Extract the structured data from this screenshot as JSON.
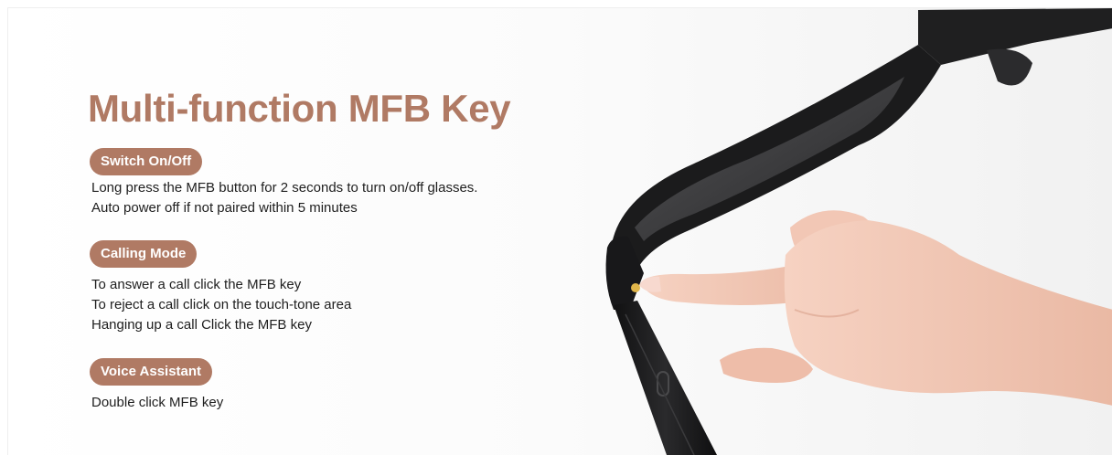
{
  "heading": "Multi-function MFB Key",
  "sections": [
    {
      "label": "Switch On/Off",
      "lines": [
        "Long press the MFB button for 2 seconds to turn on/off glasses.",
        "Auto power off if not paired within 5 minutes"
      ]
    },
    {
      "label": "Calling Mode",
      "lines": [
        "To answer a call click the MFB key",
        "To reject a call click on the touch-tone area",
        "Hanging up a call Click the MFB key"
      ]
    },
    {
      "label": "Voice Assistant",
      "lines": [
        "Double click MFB key"
      ]
    }
  ],
  "colors": {
    "accent": "#b07a64",
    "text": "#1e1e1e",
    "frame": "#1b1b1c",
    "lens": "#3c3c3e",
    "skin": "#f1c5b2",
    "button_gold": "#e1b64a"
  },
  "illustration": {
    "subject": "smart-glasses-with-finger-pressing-mfb-key"
  }
}
